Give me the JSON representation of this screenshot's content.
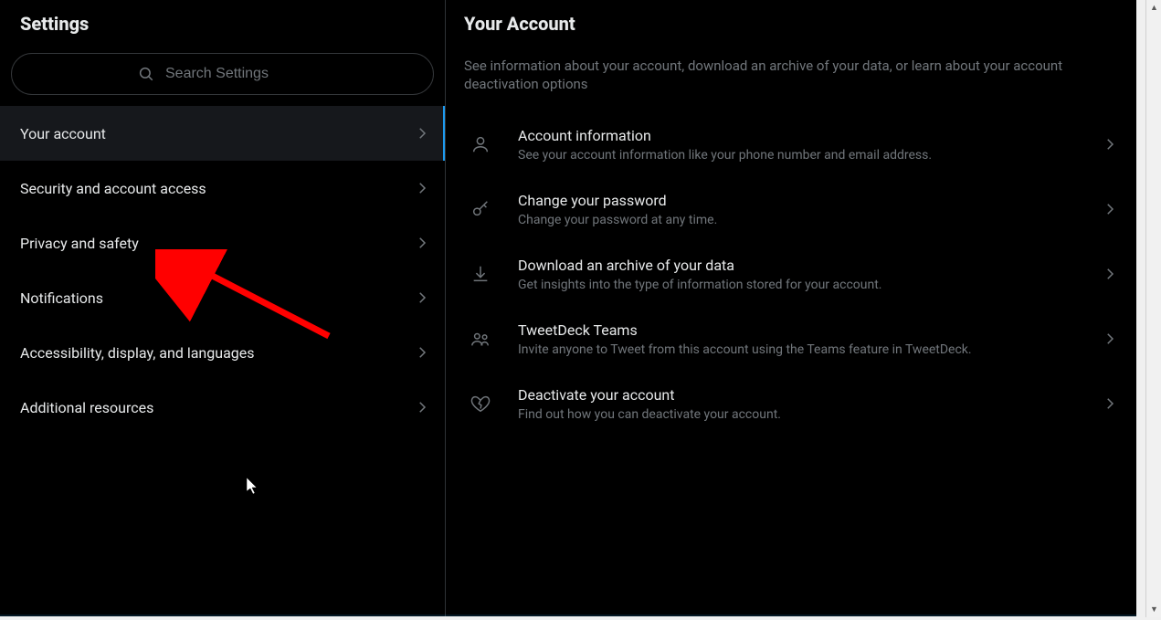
{
  "sidebar": {
    "title": "Settings",
    "search_placeholder": "Search Settings",
    "items": [
      {
        "label": "Your account",
        "active": true
      },
      {
        "label": "Security and account access",
        "active": false
      },
      {
        "label": "Privacy and safety",
        "active": false
      },
      {
        "label": "Notifications",
        "active": false
      },
      {
        "label": "Accessibility, display, and languages",
        "active": false
      },
      {
        "label": "Additional resources",
        "active": false
      }
    ]
  },
  "main": {
    "title": "Your Account",
    "description": "See information about your account, download an archive of your data, or learn about your account deactivation options",
    "rows": [
      {
        "icon": "person",
        "title": "Account information",
        "subtitle": "See your account information like your phone number and email address."
      },
      {
        "icon": "key",
        "title": "Change your password",
        "subtitle": "Change your password at any time."
      },
      {
        "icon": "download",
        "title": "Download an archive of your data",
        "subtitle": "Get insights into the type of information stored for your account."
      },
      {
        "icon": "teams",
        "title": "TweetDeck Teams",
        "subtitle": "Invite anyone to Tweet from this account using the Teams feature in TweetDeck."
      },
      {
        "icon": "heartbreak",
        "title": "Deactivate your account",
        "subtitle": "Find out how you can deactivate your account."
      }
    ]
  }
}
